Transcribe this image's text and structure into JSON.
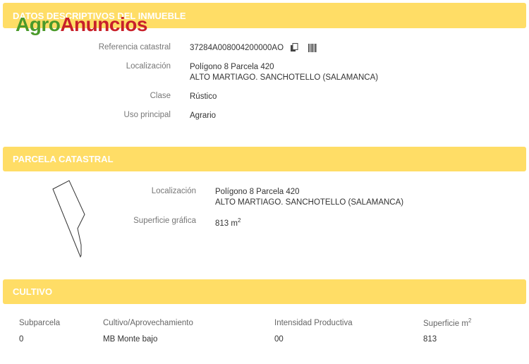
{
  "logo": {
    "part1": "Agro",
    "part2": "Anuncios"
  },
  "section1": {
    "title": "DATOS DESCRIPTIVOS DEL INMUEBLE",
    "ref_label": "Referencia catastral",
    "ref_value": "37284A008004200000AO",
    "loc_label": "Localización",
    "loc_line1": "Polígono 8 Parcela 420",
    "loc_line2": "ALTO MARTIAGO. SANCHOTELLO (SALAMANCA)",
    "clase_label": "Clase",
    "clase_value": "Rústico",
    "uso_label": "Uso principal",
    "uso_value": "Agrario"
  },
  "section2": {
    "title": "PARCELA CATASTRAL",
    "loc_label": "Localización",
    "loc_line1": "Polígono 8 Parcela 420",
    "loc_line2": "ALTO MARTIAGO. SANCHOTELLO (SALAMANCA)",
    "sup_label": "Superficie gráfica",
    "sup_value": "813 m",
    "sup_exp": "2"
  },
  "section3": {
    "title": "CULTIVO",
    "headers": {
      "subparcela": "Subparcela",
      "cultivo": "Cultivo/Aprovechamiento",
      "intensidad": "Intensidad Productiva",
      "superficie": "Superficie m",
      "superficie_exp": "2"
    },
    "row": {
      "subparcela": "0",
      "cultivo": "MB Monte bajo",
      "intensidad": "00",
      "superficie": "813"
    }
  },
  "colors": {
    "header_bg": "#ffdd66",
    "logo_green": "#4a9a2a",
    "logo_red": "#c8202a"
  },
  "icons": [
    "copy-icon",
    "barcode-icon"
  ]
}
